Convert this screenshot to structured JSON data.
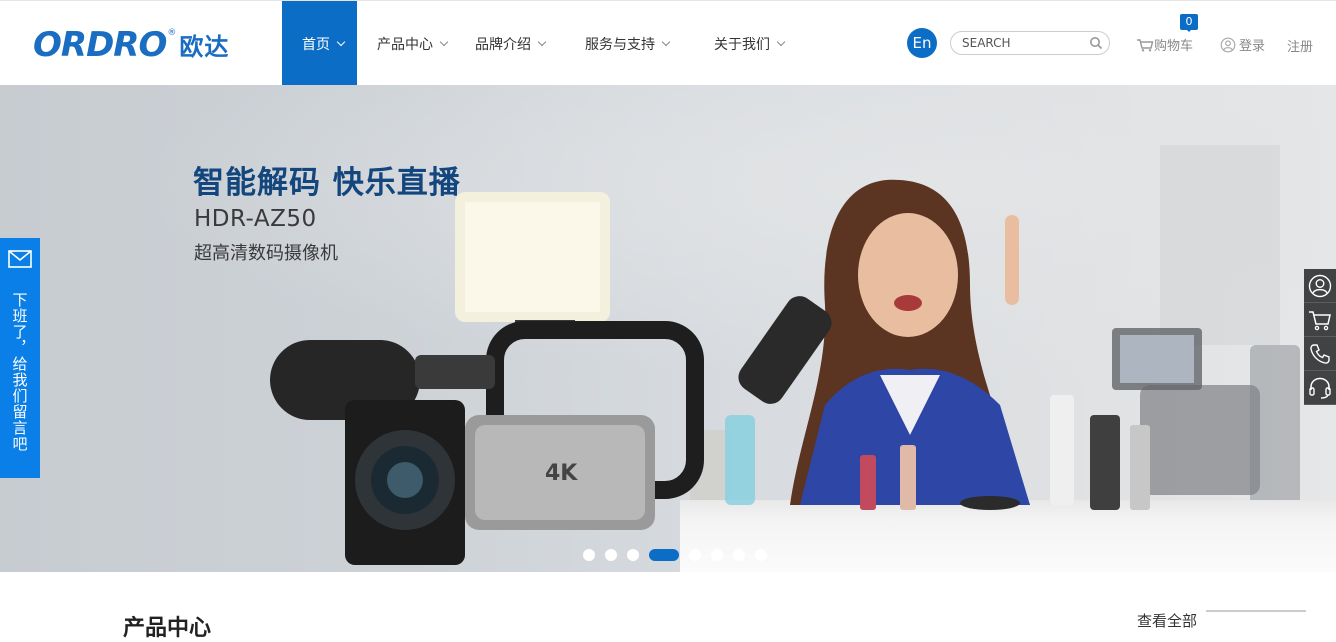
{
  "header": {
    "logo": {
      "mark": "ORDRO",
      "registered": "®",
      "cn": "欧达"
    },
    "nav": [
      {
        "label": "首页",
        "active": true
      },
      {
        "label": "产品中心"
      },
      {
        "label": "品牌介绍"
      },
      {
        "label": "服务与支持"
      },
      {
        "label": "关于我们"
      }
    ],
    "lang_label": "En",
    "search": {
      "placeholder": "SEARCH",
      "icon": "search-icon"
    },
    "cart": {
      "label": "购物车",
      "count": "0",
      "icon": "cart-icon"
    },
    "login_label": "登录",
    "register_label": "注册"
  },
  "banner": {
    "headline": "智能解码 快乐直播",
    "model": "HDR-AZ50",
    "subtitle": "超高清数码摄像机",
    "slide_count": 8,
    "active_slide": 4
  },
  "left_tab": {
    "label": "下班了，给我们留言吧",
    "icon": "mail-icon"
  },
  "right_bar": {
    "items": [
      "user-icon",
      "cart-icon",
      "phone-icon",
      "headset-icon"
    ]
  },
  "section": {
    "title": "产品中心",
    "view_all": "查看全部"
  },
  "colors": {
    "brand": "#0b6dc6",
    "side_tab": "#0b7fe8",
    "headline": "#14467e"
  }
}
